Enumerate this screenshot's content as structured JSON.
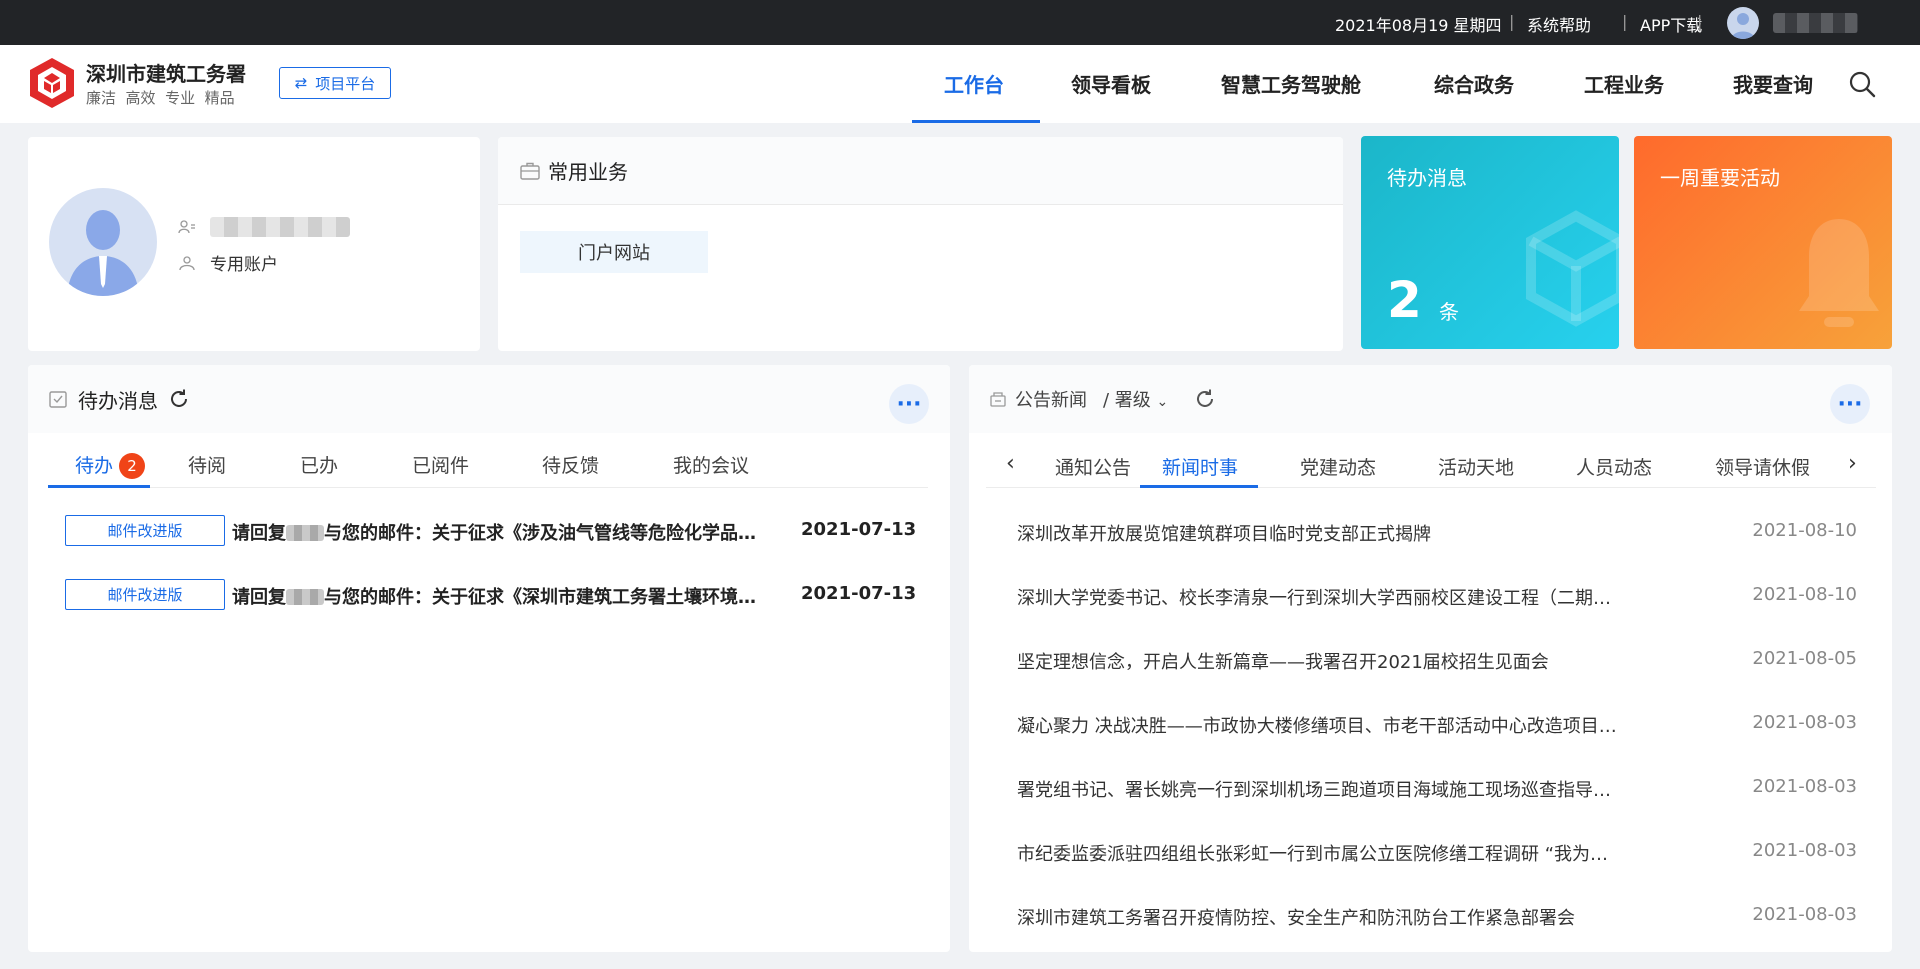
{
  "topbar": {
    "date": "2021年08月19 星期四",
    "separator": "|",
    "help": "系统帮助",
    "app_download": "APP下载"
  },
  "header": {
    "org_name": "深圳市建筑工务署",
    "slogan": "廉洁  高效  专业  精品",
    "project_platform": "项目平台",
    "nav": [
      "工作台",
      "领导看板",
      "智慧工务驾驶舱",
      "综合政务",
      "工程业务",
      "我要查询"
    ]
  },
  "profile": {
    "account_type": "专用账户"
  },
  "common_business": {
    "title": "常用业务",
    "items": [
      "门户网站"
    ]
  },
  "tiles": {
    "todo_title": "待办消息",
    "todo_count": "2",
    "todo_unit": "条",
    "week_title": "一周重要活动"
  },
  "todo_panel": {
    "title": "待办消息",
    "more": "···",
    "tabs": [
      "待办",
      "待阅",
      "已办",
      "已阅件",
      "待反馈",
      "我的会议"
    ],
    "badge": "2",
    "rows": [
      {
        "tag": "邮件改进版",
        "prefix": "请回复",
        "text": "与您的邮件：关于征求《涉及油气管线等危险化学品管道工程…",
        "date": "2021-07-13"
      },
      {
        "tag": "邮件改进版",
        "prefix": "请回复",
        "text": "与您的邮件：关于征求《深圳市建筑工务署土壤环境保护管理…",
        "date": "2021-07-13"
      }
    ]
  },
  "news_panel": {
    "title": "公告新闻",
    "level": "/ 署级",
    "more": "···",
    "tabs": [
      "通知公告",
      "新闻时事",
      "党建动态",
      "活动天地",
      "人员动态",
      "领导请休假"
    ],
    "rows": [
      {
        "title": "深圳改革开放展览馆建筑群项目临时党支部正式揭牌",
        "date": "2021-08-10"
      },
      {
        "title": "深圳大学党委书记、校长李清泉一行到深圳大学西丽校区建设工程（二期）…",
        "date": "2021-08-10"
      },
      {
        "title": "坚定理想信念，开启人生新篇章——我署召开2021届校招生见面会",
        "date": "2021-08-05"
      },
      {
        "title": "凝心聚力 决战决胜——市政协大楼修缮项目、市老干部活动中心改造项目…",
        "date": "2021-08-03"
      },
      {
        "title": "署党组书记、署长姚亮一行到深圳机场三跑道项目海域施工现场巡查指导…",
        "date": "2021-08-03"
      },
      {
        "title": "市纪委监委派驻四组组长张彩虹一行到市属公立医院修缮工程调研 “我为…",
        "date": "2021-08-03"
      },
      {
        "title": "深圳市建筑工务署召开疫情防控、安全生产和防汛防台工作紧急部署会",
        "date": "2021-08-03"
      }
    ]
  },
  "colors": {
    "accent": "#1a6be6",
    "badge": "#f04418",
    "todo_tile": "#1bb6c9",
    "week_tile": "#ff6a2c",
    "topbar": "#222427"
  }
}
